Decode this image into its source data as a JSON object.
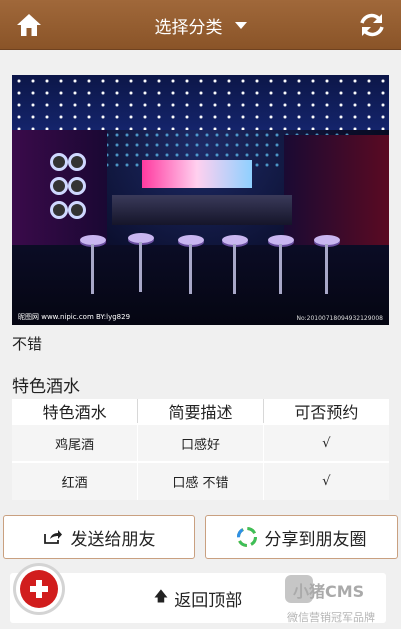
{
  "header": {
    "title": "选择分类",
    "home_icon": "home-icon",
    "refresh_icon": "refresh-icon",
    "background": "#98603a"
  },
  "photo": {
    "watermark_left": "昵图网 www.nipic.com  BY:lyg829",
    "watermark_right": "No:20100718094932129008"
  },
  "item": {
    "description": "不错",
    "section_title": "特色酒水"
  },
  "table": {
    "headers": [
      "特色酒水",
      "简要描述",
      "可否预约"
    ],
    "rows": [
      [
        "鸡尾酒",
        "口感好",
        "√"
      ],
      [
        "红酒",
        "口感 不错",
        "√"
      ]
    ]
  },
  "actions": {
    "send_label": "发送给朋友",
    "share_label": "分享到朋友圈",
    "back_top_label": "返回顶部"
  },
  "watermark": {
    "brand": "小猪CMS",
    "subtitle": "微信营销冠军品牌"
  },
  "colors": {
    "accent": "#d11d1d",
    "border": "#c9a080"
  }
}
